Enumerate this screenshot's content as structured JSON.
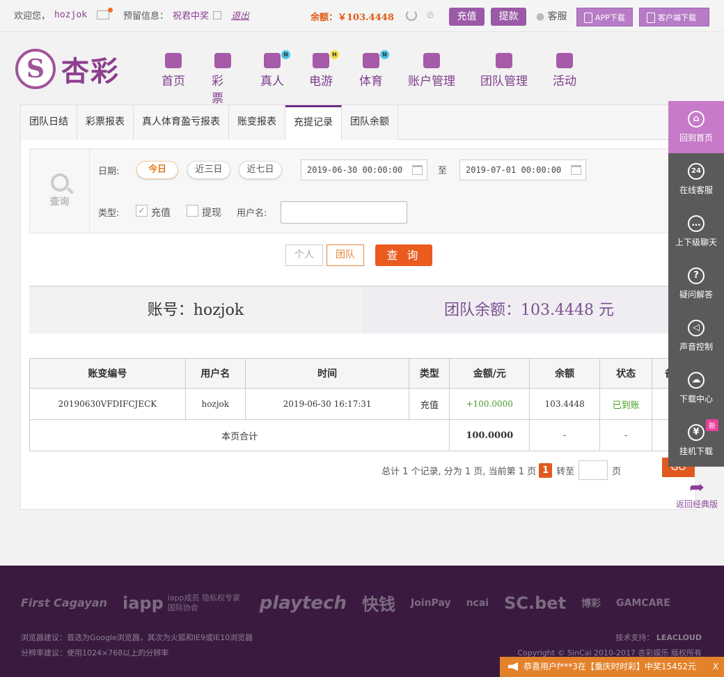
{
  "topbar": {
    "welcome": "欢迎您，",
    "username": "hozjok",
    "reserve_label": "预留信息：",
    "reserve_value": "祝君中奖",
    "logout": "退出",
    "balance_label": "余额：",
    "balance_value": "￥103.4448",
    "recharge": "充值",
    "withdraw": "提款",
    "service": "客服",
    "app_download": "APP下载",
    "client_download": "客户端下载"
  },
  "logo": {
    "text": "杏彩"
  },
  "nav": [
    {
      "label": "首页",
      "icon": "home-icon",
      "badge": ""
    },
    {
      "label": "彩票",
      "icon": "lottery-icon",
      "badge": ""
    },
    {
      "label": "真人",
      "icon": "live-dealer-icon",
      "badge": "N"
    },
    {
      "label": "电游",
      "icon": "gamepad-icon",
      "badge": "H"
    },
    {
      "label": "体育",
      "icon": "trophy-icon",
      "badge": "N"
    },
    {
      "label": "账户管理",
      "icon": "account-icon",
      "badge": ""
    },
    {
      "label": "团队管理",
      "icon": "team-icon",
      "badge": ""
    },
    {
      "label": "活动",
      "icon": "gift-icon",
      "badge": ""
    }
  ],
  "tabs": [
    "团队日结",
    "彩票报表",
    "真人体育盈亏报表",
    "账变报表",
    "充提记录",
    "团队余额"
  ],
  "query": {
    "side_label": "查询",
    "date_label": "日期:",
    "today": "今日",
    "three_days": "近三日",
    "seven_days": "近七日",
    "start_date": "2019-06-30 00:00:00",
    "to": "至",
    "end_date": "2019-07-01 00:00:00",
    "type_label": "类型:",
    "type_recharge": "充值",
    "type_withdraw": "提现",
    "username_label": "用户名:",
    "username_value": "",
    "personal": "个人",
    "team": "团队",
    "submit": "查 询"
  },
  "summary": {
    "account": "账号：hozjok",
    "team_balance": "团队余额：103.4448 元"
  },
  "table": {
    "headers": [
      "账变编号",
      "用户名",
      "时间",
      "类型",
      "金额/元",
      "余额",
      "状态",
      "备注"
    ],
    "rows": [
      [
        "20190630VFDIFCJECK",
        "hozjok",
        "2019-06-30 16:17:31",
        "充值",
        "+100.0000",
        "103.4448",
        "已到账",
        "----"
      ]
    ],
    "total_label": "本页合计",
    "total_amount": "100.0000",
    "total_balance": "-",
    "total_status": "-",
    "total_note": "-"
  },
  "pager": {
    "summary": "总计 1 个记录, 分为 1 页, 当前第 1 页",
    "current": "1",
    "goto": "转至",
    "page": "页",
    "go": "GO"
  },
  "sidebar": [
    {
      "label": "回到首页",
      "icon": "home-icon"
    },
    {
      "label": "在线客服",
      "icon": "24h-support-icon"
    },
    {
      "label": "上下级聊天",
      "icon": "chat-icon"
    },
    {
      "label": "疑问解答",
      "icon": "question-icon"
    },
    {
      "label": "声音控制",
      "icon": "sound-icon"
    },
    {
      "label": "下载中心",
      "icon": "cloud-download-icon"
    },
    {
      "label": "挂机下载",
      "icon": "money-bag-icon"
    }
  ],
  "sidebar_new": "新",
  "back_classic": "返回经典版",
  "footer": {
    "partners": [
      "First Cagayan",
      "iapp",
      "playtech",
      "快钱",
      "JoinPay",
      "ncai",
      "SC.bet",
      "博彩",
      "GAMCARE"
    ],
    "iapp_note": "iapp成员 隐私权专家国际协会",
    "browser_note": "浏览器建议：首选为Google浏览器，其次为火狐和IE9或IE10浏览器",
    "resolution_note": "分辨率建议：使用1024×768以上的分辨率",
    "tech_support": "技术支持：",
    "tech_brand": "LEACLOUD",
    "copyright": "Copyright © SinCai 2010-2017 杏彩娱乐 版权所有"
  },
  "notice": {
    "text": "恭喜用户f***3在【重庆时时彩】中奖15452元",
    "close": "X"
  },
  "colors": {
    "brand": "#8a3f8f",
    "accent": "#ea5b20",
    "footer_bg": "#3a1b3f"
  }
}
